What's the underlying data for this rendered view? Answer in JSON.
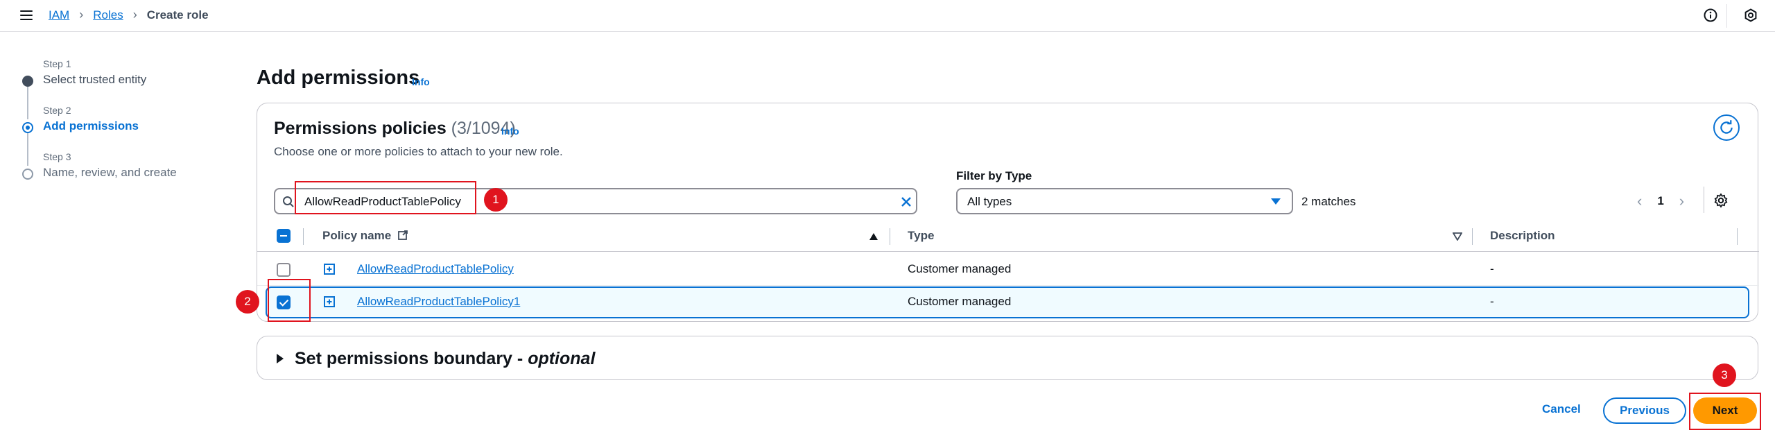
{
  "topbar": {
    "breadcrumb": [
      "IAM",
      "Roles",
      "Create role"
    ],
    "icons": [
      "menu-icon",
      "info-icon",
      "settings-icon"
    ]
  },
  "steps": [
    {
      "small": "Step 1",
      "title": "Select trusted entity",
      "state": "done"
    },
    {
      "small": "Step 2",
      "title": "Add permissions",
      "state": "active"
    },
    {
      "small": "Step 3",
      "title": "Name, review, and create",
      "state": "todo"
    }
  ],
  "header": {
    "title": "Add permissions",
    "info": "Info"
  },
  "policies": {
    "title": "Permissions policies",
    "count": "(3/1094)",
    "info": "Info",
    "description": "Choose one or more policies to attach to your new role.",
    "search_value": "AllowReadProductTablePolicy",
    "filter_label": "Filter by Type",
    "filter_value": "All types",
    "matches": "2 matches",
    "page": "1",
    "columns": [
      "Policy name",
      "Type",
      "Description"
    ],
    "rows": [
      {
        "name": "AllowReadProductTablePolicy",
        "type": "Customer managed",
        "description": "-",
        "checked": false
      },
      {
        "name": "AllowReadProductTablePolicy1",
        "type": "Customer managed",
        "description": "-",
        "checked": true
      }
    ]
  },
  "boundary": {
    "label": "Set permissions boundary - ",
    "optional": "optional"
  },
  "actions": {
    "cancel": "Cancel",
    "previous": "Previous",
    "next": "Next"
  },
  "annotations": [
    "1",
    "2",
    "3"
  ],
  "colors": {
    "accent": "#0972d3",
    "primary_button": "#ff9900",
    "annotation": "#e0141e"
  }
}
